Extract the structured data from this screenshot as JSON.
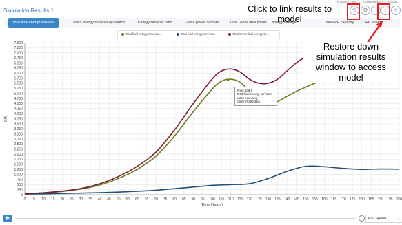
{
  "window": {
    "title": "Simulation Results 1",
    "credit": "[Insight | Forio ... | Insight Maker | ... Results ]"
  },
  "tabs": [
    {
      "label": "Total final energy services",
      "active": true
    },
    {
      "label": "Gross energy services by source"
    },
    {
      "label": "Energy services ratio"
    },
    {
      "label": "Gross power outputs"
    },
    {
      "label": "Total Gross final power ... energy storage"
    },
    {
      "label": "New RE capacity"
    },
    {
      "label": "RE energy"
    }
  ],
  "annotations": {
    "link_text": "Click to link results to model",
    "restore_text": "Restore down simulation results window to access model"
  },
  "tooltip": {
    "time": "Time: 108.5",
    "series": "Total final energy services out to economy:",
    "value": "5,659.702994551"
  },
  "controls": {
    "speed_label": "Full Speed"
  },
  "colors": {
    "series1": "#6b7a1e",
    "series2": "#1e4f7a",
    "series3": "#7a1e2f",
    "tab_active": "#3b86c9",
    "annotation": "#e02020"
  },
  "chart_data": {
    "type": "line",
    "xlabel": "Time (Years)",
    "ylabel": "GW",
    "xlim": [
      0,
      200
    ],
    "ylim": [
      0,
      7500
    ],
    "xticks": [
      0,
      5,
      10,
      15,
      20,
      25,
      30,
      35,
      40,
      45,
      50,
      55,
      60,
      65,
      70,
      75,
      80,
      85,
      90,
      95,
      100,
      105,
      110,
      115,
      120,
      125,
      130,
      135,
      140,
      145,
      150,
      155,
      160,
      165,
      170,
      175,
      180,
      185,
      190,
      195,
      200
    ],
    "yticks": [
      0,
      250,
      500,
      750,
      1000,
      1250,
      1500,
      1750,
      2000,
      2250,
      2500,
      2750,
      3000,
      3250,
      3500,
      3750,
      4000,
      4250,
      4500,
      4750,
      5000,
      5250,
      5500,
      5750,
      6000,
      6250,
      6500,
      6750,
      7000,
      7250,
      7500
    ],
    "legend_position": "top-center",
    "series": [
      {
        "name": "Total final energy services ...",
        "legend_label": "Total final energy services ...",
        "color_key": "series1",
        "x": [
          0,
          10,
          20,
          30,
          40,
          50,
          60,
          70,
          80,
          90,
          100,
          105,
          110,
          115,
          120,
          125,
          130,
          135,
          140,
          145,
          150,
          155,
          160,
          170,
          180,
          190,
          200
        ],
        "y": [
          50,
          90,
          160,
          280,
          480,
          800,
          1250,
          1900,
          2900,
          4100,
          5200,
          5600,
          5700,
          5550,
          5100,
          4600,
          4500,
          4600,
          4850,
          5100,
          5300,
          5500,
          5600,
          5650,
          5650,
          5620,
          5650
        ]
      },
      {
        "name": "Total final energy services ...",
        "legend_label": "Total final energy services ...",
        "color_key": "series2",
        "x": [
          0,
          10,
          20,
          30,
          40,
          50,
          60,
          70,
          80,
          90,
          100,
          110,
          120,
          130,
          140,
          150,
          160,
          170,
          180,
          190,
          200
        ],
        "y": [
          30,
          45,
          60,
          80,
          100,
          130,
          170,
          220,
          300,
          380,
          460,
          500,
          540,
          800,
          1150,
          1400,
          1380,
          1300,
          1250,
          1270,
          1260
        ]
      },
      {
        "name": "Total Gross final energy se...",
        "legend_label": "Total Gross final energy se...",
        "color_key": "series3",
        "x": [
          0,
          10,
          20,
          30,
          40,
          50,
          60,
          70,
          80,
          90,
          100,
          105,
          110,
          115,
          120,
          125,
          130,
          135,
          140,
          145,
          150,
          155,
          160,
          170,
          180,
          190,
          200
        ],
        "y": [
          50,
          95,
          180,
          310,
          540,
          900,
          1400,
          2100,
          3200,
          4500,
          5700,
          6100,
          6200,
          6050,
          5700,
          5500,
          5500,
          5700,
          6100,
          6500,
          6800,
          6950,
          6950,
          6950,
          6920,
          6950,
          6950
        ]
      }
    ]
  }
}
